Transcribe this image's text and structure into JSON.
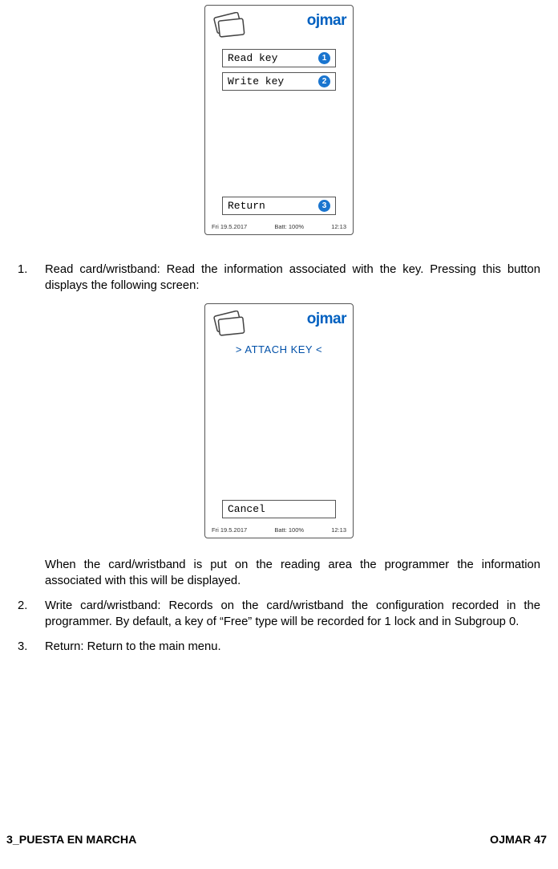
{
  "device1": {
    "brand": "ojmar",
    "buttons": {
      "read": {
        "label": "Read key",
        "num": "1"
      },
      "write": {
        "label": "Write key",
        "num": "2"
      },
      "return": {
        "label": "Return",
        "num": "3"
      }
    },
    "status": {
      "date": "Fri 19.5.2017",
      "batt": "Batt:  100%",
      "time": "12:13"
    }
  },
  "device2": {
    "brand": "ojmar",
    "header": "> ATTACH KEY <",
    "cancel": "Cancel",
    "status": {
      "date": "Fri 19.5.2017",
      "batt": "Batt:  100%",
      "time": "12:13"
    }
  },
  "list": {
    "item1": "Read card/wristband: Read the information associated with the key. Pressing this button displays the following screen:",
    "para_after1": "When the card/wristband is put on the reading area the programmer the information associated with this will be displayed.",
    "item2": "Write card/wristband: Records on the card/wristband the configuration recorded in the programmer. By default, a key of “Free” type will be recorded for 1 lock and in Subgroup 0.",
    "item3": " Return: Return to the main menu."
  },
  "footer": {
    "left": "3_PUESTA EN MARCHA",
    "right": "OJMAR 47"
  }
}
